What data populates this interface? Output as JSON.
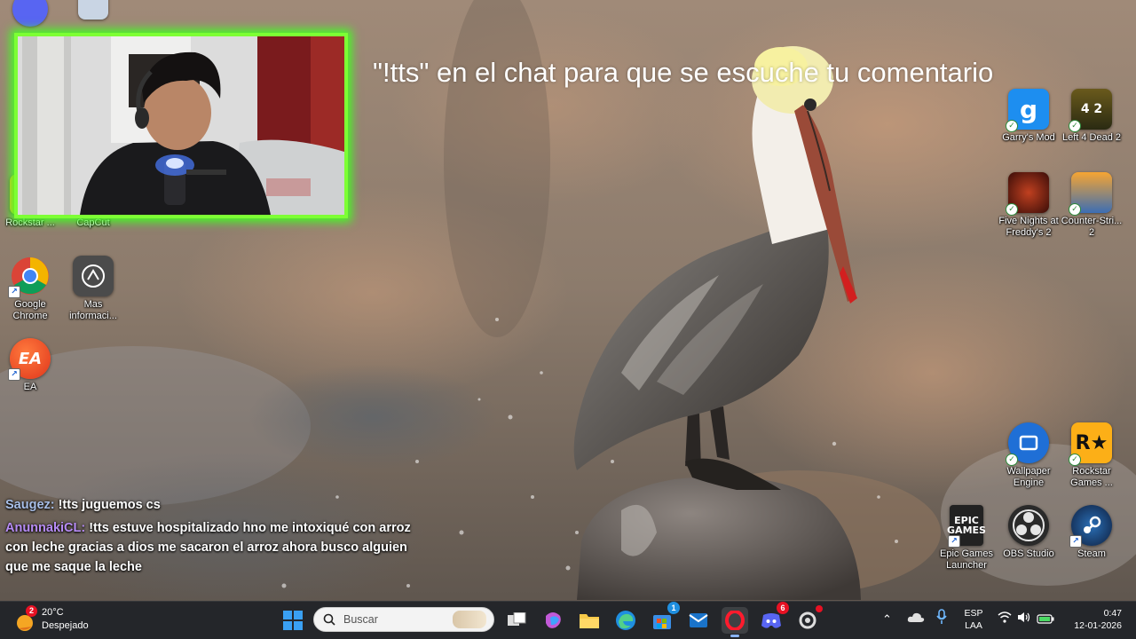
{
  "overlay": {
    "tts_banner": "\"!tts\" en el chat para que se escuche tu comentario"
  },
  "chat": [
    {
      "user": "Saugez:",
      "user_color": "#a8bfe8",
      "text": "!tts juguemos cs"
    },
    {
      "user": "AnunnakiCL:",
      "user_color": "#b78cf5",
      "text": "!tts estuve hospitalizado hno me intoxiqué con arroz con leche gracias a dios me sacaron el arroz ahora busco alguien que me saque la leche"
    }
  ],
  "desktop_icons": {
    "rockstar_left": "Rockstar ...",
    "capcut": "CapCut",
    "chrome": "Google Chrome",
    "more_info": "Mas informaci...",
    "ea": "EA",
    "garrys_mod": "Garry's Mod",
    "left4dead2": "Left 4 Dead 2",
    "fnaf2": "Five Nights at Freddy's 2",
    "counter_strike": "Counter-Stri... 2",
    "wallpaper_engine": "Wallpaper Engine",
    "rockstar_games": "Rockstar Games ...",
    "epic": "Epic Games Launcher",
    "obs": "OBS Studio",
    "steam": "Steam"
  },
  "taskbar": {
    "weather_temp": "20°C",
    "weather_desc": "Despejado",
    "weather_badge": "2",
    "search_placeholder": "Buscar",
    "store_badge": "1",
    "discord_badge": "6",
    "language": "ESP",
    "layout": "LAA",
    "time": "0:47",
    "date": "12-01-2026"
  },
  "colors": {
    "cam_border": "#7dff34",
    "taskbar_bg": "#202228",
    "chat_user_1": "#a8bfe8",
    "chat_user_2": "#b78cf5"
  }
}
